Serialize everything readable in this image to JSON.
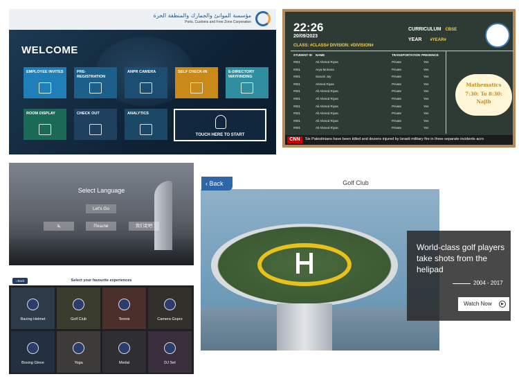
{
  "welcome_panel": {
    "logo_arabic": "مؤسسة الموانئ والجمارك والمنطقة الحرة",
    "logo_english": "Ports, Customs and Free Zone Corporation",
    "heading": "WELCOME",
    "tiles": [
      {
        "label": "EMPLOYEE INVITES",
        "color": "#1f7fb8",
        "icon": "envelope-icon"
      },
      {
        "label": "PRE-REGISTRATION",
        "color": "#1b5f8a",
        "icon": "id-card-icon"
      },
      {
        "label": "ANPR CAMERA",
        "color": "#1c4d73",
        "icon": "camera-icon"
      },
      {
        "label": "SELF CHECK-IN",
        "color": "#c98a1a",
        "icon": "checkin-icon"
      },
      {
        "label": "E-DIRECTORY WAYFINDING",
        "color": "#2f8fa1",
        "icon": "map-icon"
      },
      {
        "label": "ROOM DISPLAY",
        "color": "#1b6a55",
        "icon": "screen-icon"
      },
      {
        "label": "CHECK OUT",
        "color": "#204060",
        "icon": "checkout-icon"
      },
      {
        "label": "ANALYTICS",
        "color": "#1c4868",
        "icon": "chart-icon"
      }
    ],
    "touch_label": "TOUCH HERE TO START"
  },
  "school_board": {
    "time": "22:26",
    "date": "20/09/2023",
    "class_label": "CLASS: #CLASS#   DIVISION: #DIVISION#",
    "curriculum_label": "CURRICULUM",
    "curriculum_value": "CBSE",
    "year_label": "YEAR",
    "year_value": "#YEAR#",
    "columns": [
      "STUDENT ID",
      "NAME",
      "TRANSPORTATION",
      "PRESENCE"
    ],
    "rows": [
      [
        "#001",
        "Ali Ahmed Riyas",
        "Private",
        "Yes"
      ],
      [
        "#001",
        "Arya Mohana",
        "Private",
        "Yes"
      ],
      [
        "#001",
        "Surumi Jay",
        "Private",
        "Yes"
      ],
      [
        "#001",
        "Ahmed Riyas",
        "Private",
        "Yes"
      ],
      [
        "#001",
        "Ali Ahmed Riyas",
        "Private",
        "Yes"
      ],
      [
        "#001",
        "Ali Ahmed Riyas",
        "Private",
        "Yes"
      ],
      [
        "#001",
        "Ali Ahmed Riyas",
        "Private",
        "Yes"
      ],
      [
        "#001",
        "Ali Ahmed Riyas",
        "Private",
        "Yes"
      ],
      [
        "#001",
        "Ali Ahmed Riyas",
        "Private",
        "Yes"
      ],
      [
        "#001",
        "Ali Ahmed Riyas",
        "Private",
        "Yes"
      ]
    ],
    "subject": "Mathematics",
    "subject_time": "7:30: To 8:30:",
    "teacher": "Najib",
    "ticker_source": "CNN",
    "ticker_text": "Six Palestinians have been killed and dozens injured by Israeli military fire in three separate incidents acro"
  },
  "language_panel": {
    "title": "Select Language",
    "go_label": "Let's Go",
    "languages": [
      "يلا",
      "Пошли",
      "我们走吧"
    ]
  },
  "experiences_panel": {
    "back_label": "Back",
    "title": "Select your favourite experiences",
    "items": [
      {
        "label": "Racing Helmet",
        "icon": "helmet-icon"
      },
      {
        "label": "Golf Club",
        "icon": "golf-icon"
      },
      {
        "label": "Tennis",
        "icon": "tennis-icon"
      },
      {
        "label": "Camera Gopro",
        "icon": "camera-icon"
      },
      {
        "label": "Boxing Glove",
        "icon": "boxing-glove-icon"
      },
      {
        "label": "Yoga",
        "icon": "yoga-icon"
      },
      {
        "label": "Medal",
        "icon": "medal-icon"
      },
      {
        "label": "DJ Set",
        "icon": "dj-icon"
      }
    ]
  },
  "golf_panel": {
    "back_label": "Back",
    "title": "Golf Club",
    "headline": "World-class golf players take shots from the helipad",
    "years": "2004 - 2017",
    "watch_label": "Watch Now"
  }
}
